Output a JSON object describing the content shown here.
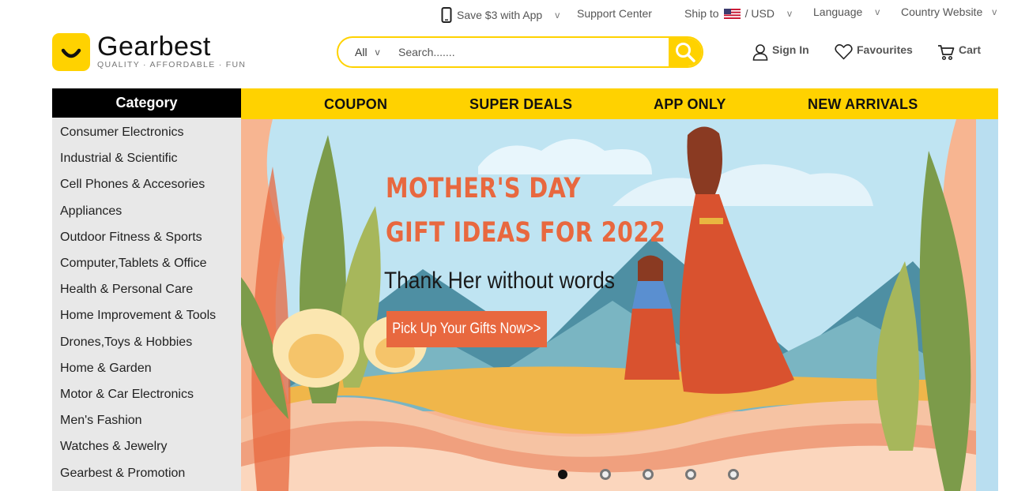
{
  "topbar": {
    "app": "Save $3 with App",
    "support": "Support Center",
    "ship_to": "Ship to",
    "currency": "/ USD",
    "language": "Language",
    "country": "Country Website"
  },
  "logo": {
    "name": "Gearbest",
    "tagline": "QUALITY · AFFORDABLE · FUN"
  },
  "search": {
    "scope": "All",
    "placeholder": "Search......."
  },
  "account": {
    "sign_in": "Sign In",
    "favourites": "Favourites",
    "cart": "Cart"
  },
  "nav": {
    "category": "Category",
    "links": [
      "COUPON",
      "SUPER DEALS",
      "APP ONLY",
      "NEW ARRIVALS"
    ]
  },
  "sidebar": {
    "items": [
      "Consumer Electronics",
      "Industrial & Scientific",
      "Cell Phones & Accesories",
      "Appliances",
      "Outdoor Fitness & Sports",
      "Computer,Tablets & Office",
      "Health & Personal Care",
      "Home Improvement & Tools",
      "Drones,Toys & Hobbies",
      "Home & Garden",
      "Motor & Car Electronics",
      "Men's Fashion",
      "Watches & Jewelry",
      "Gearbest & Promotion"
    ]
  },
  "banner": {
    "title_line1": "MOTHER'S DAY",
    "title_line2": "GIFT IDEAS FOR 2022",
    "subtitle": "Thank Her without words",
    "cta": "Pick Up Your Gifts Now>>",
    "slide_count": 5,
    "active_slide": 1,
    "colors": {
      "accent": "#e8683f",
      "sky": "#bfe4f2",
      "frame": "#f7b591"
    }
  },
  "colors": {
    "brand_yellow": "#ffd200",
    "category_bg": "#000000",
    "sidebar_bg": "#e8e8e8"
  }
}
